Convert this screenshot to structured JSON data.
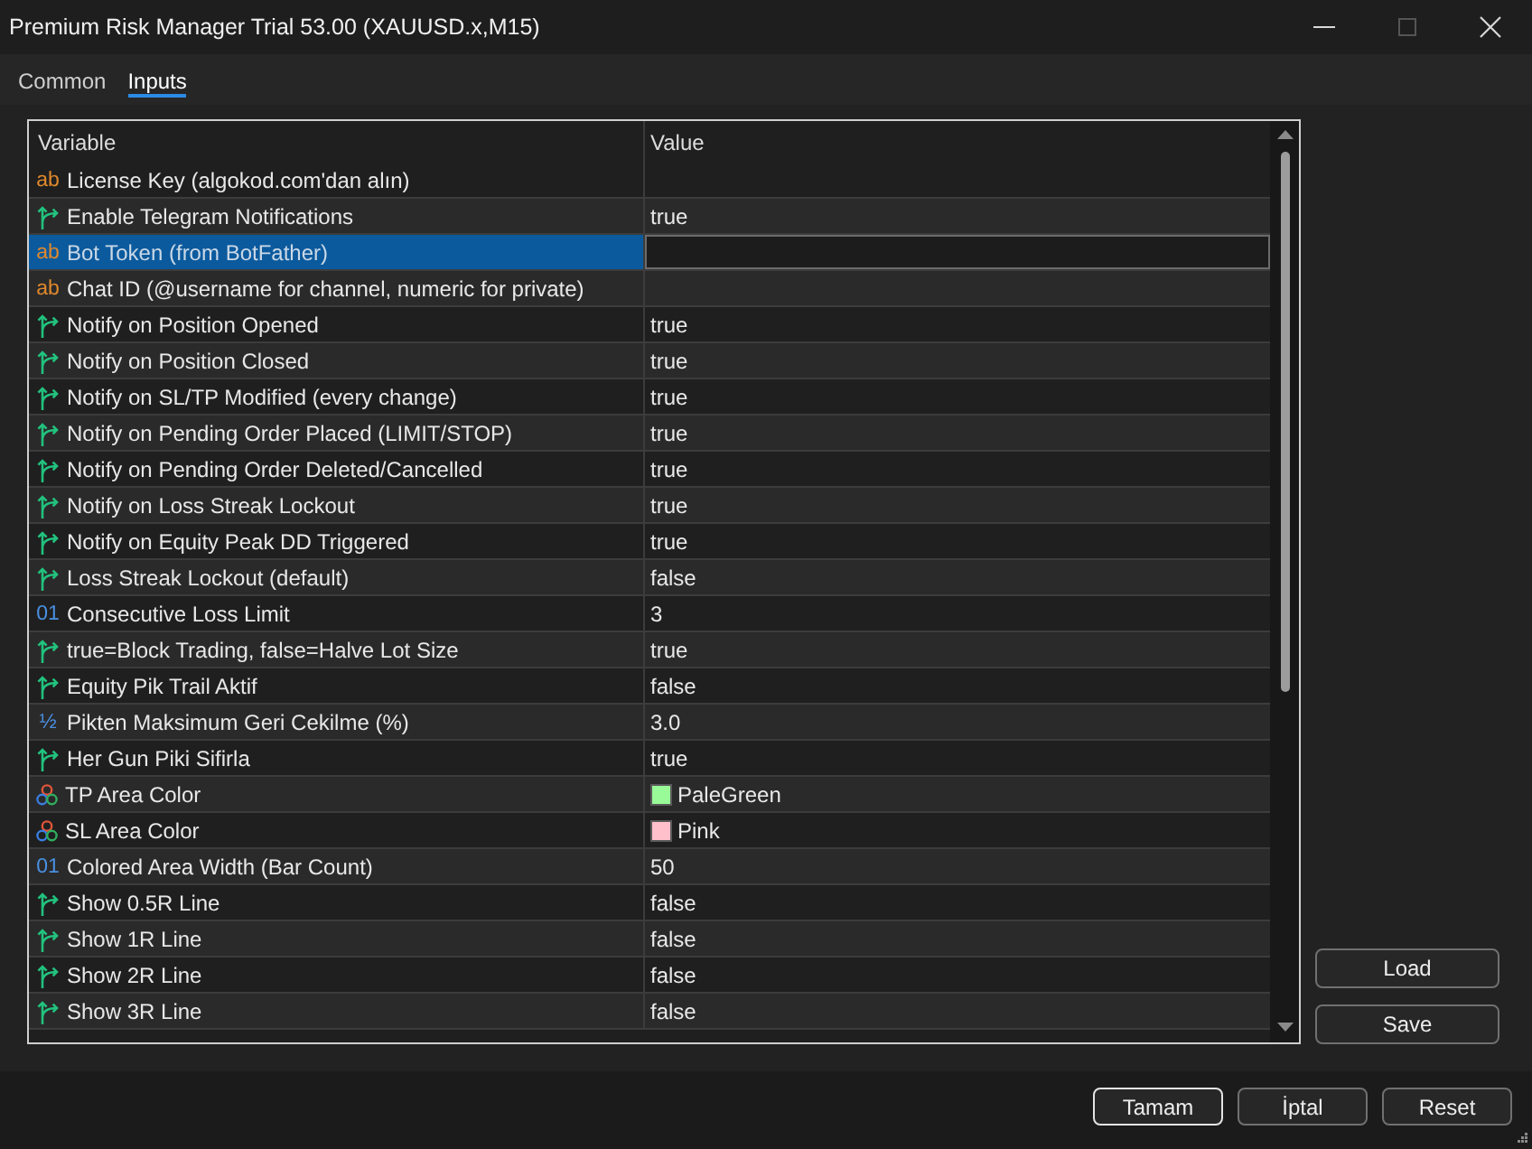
{
  "window": {
    "title": "Premium Risk Manager Trial 53.00 (XAUUSD.x,M15)",
    "controls": [
      {
        "kind": "minimize",
        "disabled": false
      },
      {
        "kind": "maximize",
        "disabled": true
      },
      {
        "kind": "close",
        "disabled": false
      }
    ]
  },
  "tabs": [
    {
      "label": "Common",
      "selected": false
    },
    {
      "label": "Inputs",
      "selected": true
    }
  ],
  "table": {
    "columns": [
      "Variable",
      "Value"
    ],
    "rows": [
      {
        "kind": "string",
        "type_glyph": "ab",
        "variable": "License Key (algokod.com'dan alın)",
        "selected": false
      },
      {
        "kind": "bool",
        "variable": "Enable Telegram Notifications",
        "value": "true",
        "selected": false
      },
      {
        "kind": "string",
        "type_glyph": "ab",
        "variable": "Bot Token (from BotFather)",
        "selected": true
      },
      {
        "kind": "string",
        "type_glyph": "ab",
        "variable": "Chat ID (@username for channel, numeric for private)",
        "selected": false
      },
      {
        "kind": "bool",
        "variable": "Notify on Position Opened",
        "value": "true",
        "selected": false
      },
      {
        "kind": "bool",
        "variable": "Notify on Position Closed",
        "value": "true",
        "selected": false
      },
      {
        "kind": "bool",
        "variable": "Notify on SL/TP Modified (every change)",
        "value": "true",
        "selected": false
      },
      {
        "kind": "bool",
        "variable": "Notify on Pending Order Placed (LIMIT/STOP)",
        "value": "true",
        "selected": false
      },
      {
        "kind": "bool",
        "variable": "Notify on Pending Order Deleted/Cancelled",
        "value": "true",
        "selected": false
      },
      {
        "kind": "bool",
        "variable": "Notify on Loss Streak Lockout",
        "value": "true",
        "selected": false
      },
      {
        "kind": "bool",
        "variable": "Notify on Equity Peak DD Triggered",
        "value": "true",
        "selected": false
      },
      {
        "kind": "bool",
        "variable": "Loss Streak Lockout (default)",
        "value": "false",
        "selected": false
      },
      {
        "kind": "int",
        "type_glyph": "01",
        "variable": "Consecutive Loss Limit",
        "value": "3",
        "selected": false
      },
      {
        "kind": "bool",
        "variable": "true=Block Trading, false=Halve Lot Size",
        "value": "true",
        "selected": false
      },
      {
        "kind": "bool",
        "variable": "Equity Pik Trail Aktif",
        "value": "false",
        "selected": false
      },
      {
        "kind": "double",
        "type_glyph": "½",
        "variable": "Pikten Maksimum Geri Cekilme (%)",
        "value": "3.0",
        "selected": false
      },
      {
        "kind": "bool",
        "variable": "Her Gun Piki Sifirla",
        "value": "true",
        "selected": false
      },
      {
        "kind": "color",
        "variable": "TP Area Color",
        "value": "PaleGreen",
        "color": "#98fb98",
        "selected": false
      },
      {
        "kind": "color",
        "variable": "SL Area Color",
        "value": "Pink",
        "color": "#ffc0cb",
        "selected": false
      },
      {
        "kind": "int",
        "type_glyph": "01",
        "variable": "Colored Area Width (Bar Count)",
        "value": "50",
        "selected": false
      },
      {
        "kind": "bool",
        "variable": "Show 0.5R Line",
        "value": "false",
        "selected": false
      },
      {
        "kind": "bool",
        "variable": "Show 1R Line",
        "value": "false",
        "selected": false
      },
      {
        "kind": "bool",
        "variable": "Show 2R Line",
        "value": "false",
        "selected": false
      },
      {
        "kind": "bool",
        "variable": "Show 3R Line",
        "value": "false",
        "selected": false
      }
    ]
  },
  "load_button": "Load",
  "save_button": "Save",
  "ok_button": {
    "label": "Tamam",
    "default": true
  },
  "cancel_button": {
    "label": "İptal",
    "default": false
  },
  "reset_button": {
    "label": "Reset",
    "default": false
  }
}
